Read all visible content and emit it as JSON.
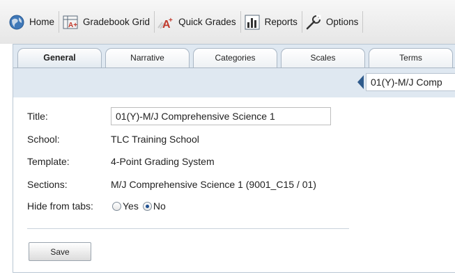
{
  "toolbar": {
    "items": [
      {
        "label": "Home",
        "icon": "globe-icon"
      },
      {
        "label": "Gradebook Grid",
        "icon": "gradebook-grid-icon"
      },
      {
        "label": "Quick Grades",
        "icon": "quick-grades-icon"
      },
      {
        "label": "Reports",
        "icon": "reports-chart-icon"
      },
      {
        "label": "Options",
        "icon": "options-wrench-icon"
      }
    ]
  },
  "tabs": [
    {
      "label": "General",
      "active": true
    },
    {
      "label": "Narrative",
      "active": false
    },
    {
      "label": "Categories",
      "active": false
    },
    {
      "label": "Scales",
      "active": false
    },
    {
      "label": "Terms",
      "active": false
    }
  ],
  "section_selector": {
    "value": "01(Y)-M/J Comp"
  },
  "form": {
    "title_label": "Title:",
    "title_value": "01(Y)-M/J Comprehensive Science 1",
    "school_label": "School:",
    "school_value": "TLC Training School",
    "template_label": "Template:",
    "template_value": "4-Point Grading System",
    "sections_label": "Sections:",
    "sections_value": "M/J Comprehensive Science 1 (9001_C15 / 01)",
    "hide_label": "Hide from tabs:",
    "hide_options": [
      {
        "label": "Yes",
        "selected": false
      },
      {
        "label": "No",
        "selected": true
      }
    ],
    "save_label": "Save"
  },
  "colors": {
    "tab_background": "#dfe8f1",
    "accent_blue": "#2f5b8c",
    "radio_selected": "#1d4f91"
  }
}
